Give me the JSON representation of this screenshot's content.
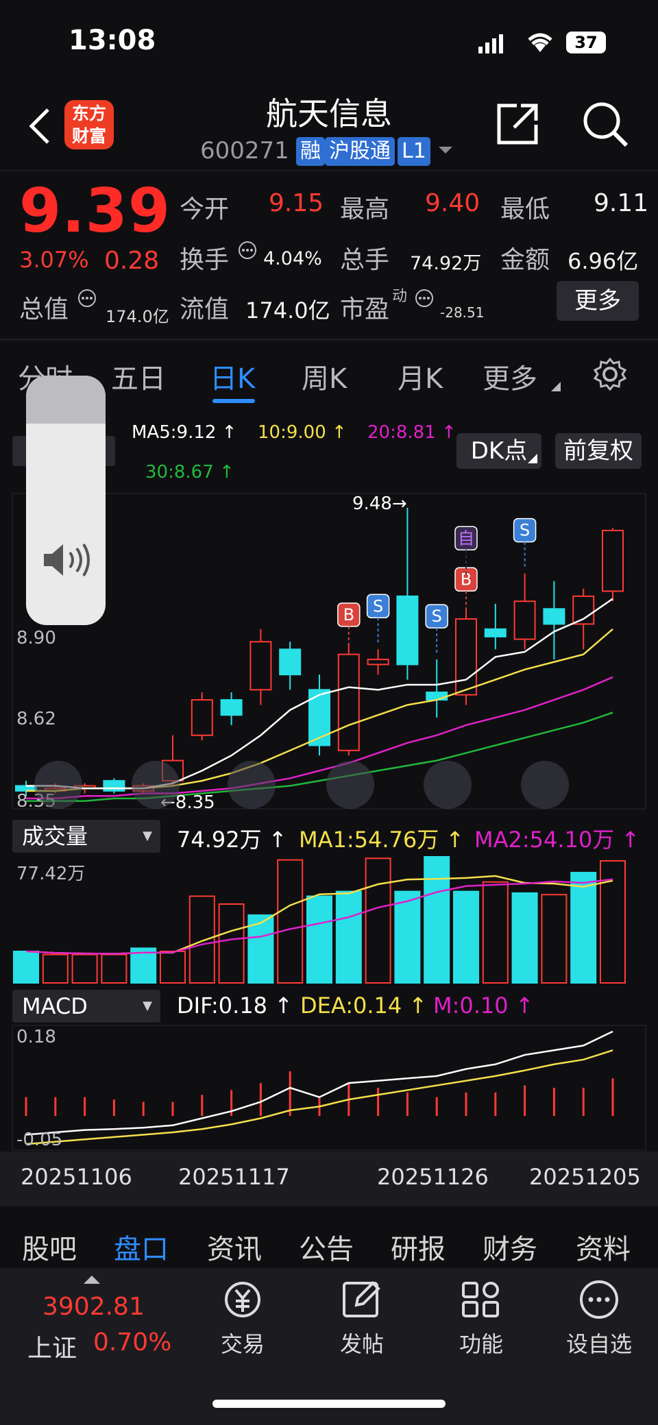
{
  "status": {
    "time": "13:08",
    "battery": "37"
  },
  "header": {
    "logo_line1": "东方",
    "logo_line2": "财富",
    "title": "航天信息",
    "code": "600271",
    "tags": [
      "融",
      "沪股通",
      "L1"
    ]
  },
  "quote": {
    "price": "9.39",
    "change_pct": "3.07%",
    "change": "0.28",
    "labels": {
      "open": "今开",
      "high": "最高",
      "low": "最低",
      "turnover": "换手",
      "volume": "总手",
      "amount": "金额",
      "mktcap": "总值",
      "float": "流值",
      "pe": "市盈",
      "pe_sup": "动"
    },
    "open": "9.15",
    "high": "9.40",
    "low": "9.11",
    "turnover": "4.04%",
    "volume": "74.92万",
    "amount": "6.96亿",
    "mktcap": "174.0亿",
    "float": "174.0亿",
    "pe": "-28.51",
    "more_button": "更多"
  },
  "ktabs": {
    "items": [
      "分时",
      "五日",
      "日K",
      "周K",
      "月K",
      "更多"
    ],
    "active": "日K"
  },
  "indicators": {
    "ma5": "MA5:9.12 ↑",
    "ma10": "10:9.00 ↑",
    "ma20": "20:8.81 ↑",
    "ma30": "30:8.67 ↑",
    "dk_button": "DK点",
    "adjust_button": "前复权",
    "colors": {
      "ma5": "#ffffff",
      "ma10": "#f5e04b",
      "ma20": "#e021c8",
      "ma30": "#22b83a",
      "up": "#ff3a33",
      "down": "#28e0e6"
    }
  },
  "chart_data": [
    {
      "type": "candlestick",
      "y_ticks": [
        "8.90",
        "8.62",
        "8.35"
      ],
      "ylim": [
        8.3,
        9.52
      ],
      "high_marker": "9.48→",
      "low_marker": "←8.35",
      "x_ticks": [
        "20251106",
        "20251117",
        "20251126",
        "20251205"
      ],
      "candles": [
        {
          "o": 8.38,
          "c": 8.36,
          "h": 8.4,
          "l": 8.34
        },
        {
          "o": 8.36,
          "c": 8.37,
          "h": 8.39,
          "l": 8.35
        },
        {
          "o": 8.37,
          "c": 8.38,
          "h": 8.39,
          "l": 8.35
        },
        {
          "o": 8.4,
          "c": 8.36,
          "h": 8.41,
          "l": 8.35
        },
        {
          "o": 8.36,
          "c": 8.38,
          "h": 8.39,
          "l": 8.35
        },
        {
          "o": 8.4,
          "c": 8.48,
          "h": 8.58,
          "l": 8.38
        },
        {
          "o": 8.58,
          "c": 8.72,
          "h": 8.75,
          "l": 8.56
        },
        {
          "o": 8.72,
          "c": 8.66,
          "h": 8.75,
          "l": 8.62
        },
        {
          "o": 8.76,
          "c": 8.95,
          "h": 9.0,
          "l": 8.7
        },
        {
          "o": 8.92,
          "c": 8.82,
          "h": 8.95,
          "l": 8.76
        },
        {
          "o": 8.76,
          "c": 8.54,
          "h": 8.82,
          "l": 8.5
        },
        {
          "o": 8.52,
          "c": 8.9,
          "h": 8.94,
          "l": 8.5
        },
        {
          "o": 8.86,
          "c": 8.88,
          "h": 8.92,
          "l": 8.82
        },
        {
          "o": 9.13,
          "c": 8.86,
          "h": 9.48,
          "l": 8.8
        },
        {
          "o": 8.75,
          "c": 8.72,
          "h": 8.88,
          "l": 8.65
        },
        {
          "o": 8.74,
          "c": 9.04,
          "h": 9.08,
          "l": 8.7
        },
        {
          "o": 9.0,
          "c": 8.97,
          "h": 9.1,
          "l": 8.92
        },
        {
          "o": 8.96,
          "c": 9.11,
          "h": 9.22,
          "l": 8.92
        },
        {
          "o": 9.08,
          "c": 9.02,
          "h": 9.19,
          "l": 8.88
        },
        {
          "o": 9.02,
          "c": 9.13,
          "h": 9.16,
          "l": 8.92
        },
        {
          "o": 9.15,
          "c": 9.39,
          "h": 9.4,
          "l": 9.11
        }
      ],
      "ma5": [
        8.38,
        8.38,
        8.37,
        8.37,
        8.37,
        8.39,
        8.44,
        8.5,
        8.58,
        8.68,
        8.74,
        8.77,
        8.76,
        8.78,
        8.78,
        8.8,
        8.89,
        8.91,
        8.99,
        9.04,
        9.12
      ],
      "ma10": [
        8.36,
        8.36,
        8.37,
        8.37,
        8.37,
        8.38,
        8.4,
        8.43,
        8.47,
        8.52,
        8.57,
        8.62,
        8.66,
        8.7,
        8.72,
        8.76,
        8.8,
        8.84,
        8.87,
        8.9,
        9.0
      ],
      "ma20": [
        8.33,
        8.33,
        8.34,
        8.34,
        8.35,
        8.35,
        8.36,
        8.37,
        8.39,
        8.41,
        8.44,
        8.47,
        8.51,
        8.55,
        8.58,
        8.62,
        8.65,
        8.68,
        8.72,
        8.76,
        8.81
      ],
      "ma30": [
        8.32,
        8.32,
        8.32,
        8.33,
        8.33,
        8.34,
        8.35,
        8.36,
        8.37,
        8.38,
        8.4,
        8.42,
        8.44,
        8.46,
        8.48,
        8.51,
        8.54,
        8.57,
        8.6,
        8.63,
        8.67
      ],
      "signals": [
        {
          "type": "B",
          "index": 11
        },
        {
          "type": "S",
          "index": 12
        },
        {
          "type": "S",
          "index": 14
        },
        {
          "type": "B",
          "index": 15
        },
        {
          "type": "S",
          "index": 17
        },
        {
          "type": "自",
          "index": 15
        }
      ]
    },
    {
      "type": "bar",
      "title": "成交量",
      "summary": "74.92万 ↑",
      "ma1": "MA1:54.76万 ↑",
      "ma2": "MA2:54.10万 ↑",
      "y_top_label": "77.42万",
      "values": [
        20,
        18,
        18,
        18,
        22,
        20,
        55,
        50,
        43,
        78,
        55,
        58,
        79,
        58,
        80,
        58,
        64,
        57,
        56,
        70,
        77.42
      ],
      "up": [
        false,
        true,
        true,
        true,
        false,
        true,
        true,
        true,
        false,
        true,
        false,
        false,
        true,
        false,
        false,
        false,
        true,
        false,
        true,
        false,
        true
      ]
    },
    {
      "type": "macd",
      "title": "MACD",
      "dif_label": "DIF:0.18 ↑",
      "dea_label": "DEA:0.14 ↑",
      "m_label": "M:0.10 ↑",
      "y_top_label": "0.18",
      "y_bottom_label": "-0.05",
      "ylim": [
        -0.07,
        0.19
      ],
      "dif": [
        -0.04,
        -0.035,
        -0.03,
        -0.028,
        -0.025,
        -0.02,
        -0.005,
        0.01,
        0.03,
        0.06,
        0.04,
        0.07,
        0.075,
        0.08,
        0.085,
        0.1,
        0.11,
        0.13,
        0.14,
        0.15,
        0.18
      ],
      "dea": [
        -0.06,
        -0.055,
        -0.05,
        -0.045,
        -0.04,
        -0.035,
        -0.028,
        -0.018,
        -0.005,
        0.012,
        0.02,
        0.035,
        0.045,
        0.055,
        0.065,
        0.075,
        0.085,
        0.097,
        0.11,
        0.12,
        0.14
      ],
      "m": [
        0.04,
        0.04,
        0.04,
        0.035,
        0.03,
        0.03,
        0.045,
        0.055,
        0.07,
        0.095,
        0.04,
        0.07,
        0.06,
        0.05,
        0.04,
        0.05,
        0.05,
        0.065,
        0.06,
        0.06,
        0.08
      ]
    }
  ],
  "bottom_tabs": {
    "items": [
      "股吧",
      "盘口",
      "资讯",
      "公告",
      "研报",
      "财务",
      "资料"
    ],
    "active": "盘口"
  },
  "footer": {
    "index_value": "3902.81",
    "index_name": "上证",
    "index_change": "0.70%",
    "buttons": [
      "交易",
      "发帖",
      "功能",
      "设自选"
    ]
  }
}
